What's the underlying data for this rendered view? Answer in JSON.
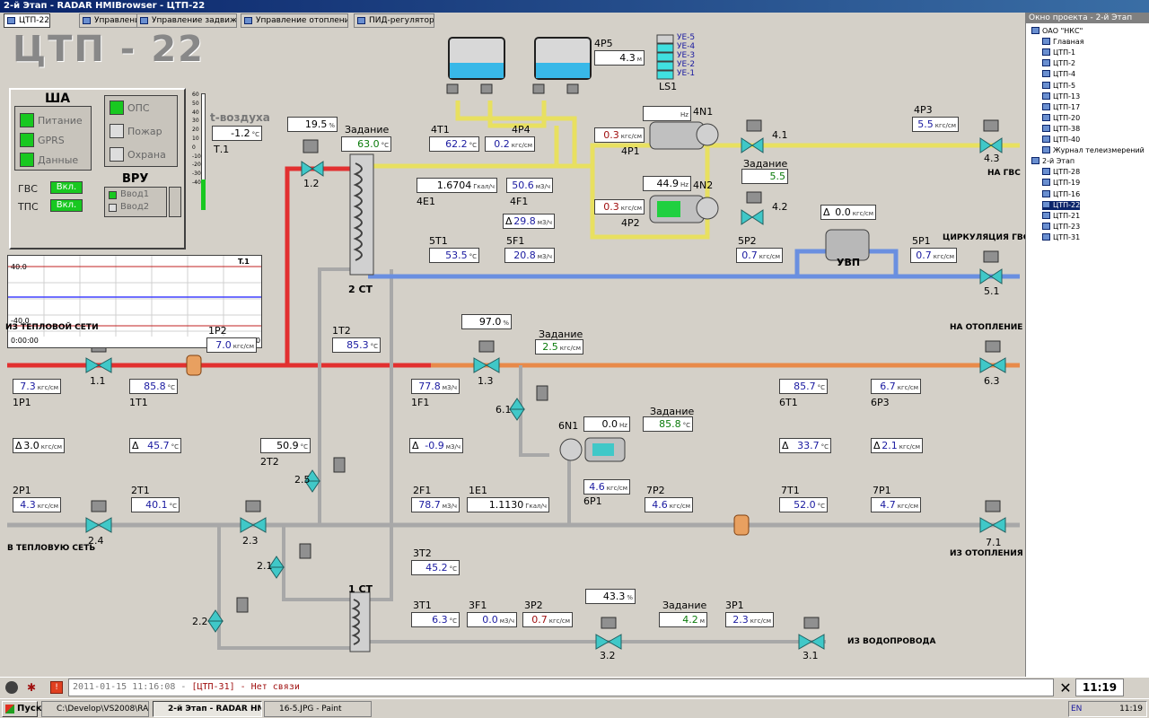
{
  "window": {
    "title": "2-й Этап - RADAR HMIBrowser - ЦТП-22"
  },
  "tabs": [
    "ЦТП-22",
    "Управление ГВС",
    "Управление задвижкой",
    "Управление отоплением",
    "ПИД-регуляторы"
  ],
  "page_title": "ЦТП - 22",
  "sha": {
    "title": "ША",
    "items": [
      "Питание",
      "GPRS",
      "Данные"
    ],
    "gvs_label": "ГВС",
    "tps_label": "ТПС",
    "on_label": "Вкл.",
    "ops_items": [
      "ОПС",
      "Пожар",
      "Охрана"
    ],
    "vru_title": "ВРУ",
    "vru_items": [
      "Ввод1",
      "Ввод2"
    ]
  },
  "air": {
    "label": "t-воздуха",
    "value": "-1.2",
    "unit": "°C",
    "tag": "Т.1",
    "scale": [
      "60",
      "50",
      "40",
      "30",
      "20",
      "10",
      "0",
      "-10",
      "-20",
      "-30",
      "-40"
    ]
  },
  "trend": {
    "tag": "T.1",
    "ymax": "40.0",
    "ymin": "-40.0",
    "time": "0:00:00",
    "end": "00:00"
  },
  "tree": {
    "header": "Окно проекта - 2-й Этап",
    "items": [
      "ОАО \"НКС\"",
      "Главная",
      "ЦТП-1",
      "ЦТП-2",
      "ЦТП-4",
      "ЦТП-5",
      "ЦТП-13",
      "ЦТП-17",
      "ЦТП-20",
      "ЦТП-38",
      "ЦТП-40",
      "Журнал телеизмерений",
      "2-й Этап",
      "ЦТП-28",
      "ЦТП-19",
      "ЦТП-16",
      "ЦТП-22",
      "ЦТП-21",
      "ЦТП-23",
      "ЦТП-31"
    ],
    "selected": 16
  },
  "tank": {
    "tag": "4Р5",
    "value": "4.3",
    "unit": "м",
    "ls": "LS1",
    "levels": [
      "УЕ-5",
      "УЕ-4",
      "УЕ-3",
      "УЕ-2",
      "УЕ-1"
    ]
  },
  "labels": {
    "setpoint": "Задание",
    "to_gvs": "НА ГВС",
    "circ_gvs": "ЦИРКУЛЯЦИЯ ГВС",
    "from_heat": "ИЗ ТЕПЛОВОЙ СЕТИ",
    "to_heating": "НА ОТОПЛЕНИЕ",
    "to_heat_net": "В ТЕПЛОВУЮ СЕТЬ",
    "from_heating": "ИЗ ОТОПЛЕНИЯ",
    "from_water": "ИЗ ВОДОПРОВОДА",
    "uvp": "УВП",
    "st2": "2 СТ",
    "st1": "1 СТ"
  },
  "values": {
    "v12pct": "19.5",
    "sp12": "63.0",
    "t41": "62.2",
    "p44": "0.2",
    "n41hz": "",
    "p41": "0.3",
    "sp42": "5.5",
    "p43": "5.5",
    "e41": "1.6704",
    "f41": "50.6",
    "df41": "29.8",
    "n42hz": "44.9",
    "p42": "0.3",
    "uvp": "0.0",
    "t51": "53.5",
    "f51": "20.8",
    "p52": "0.7",
    "p51": "0.7",
    "p12": "7.0",
    "t12": "85.3",
    "v13pct": "97.0",
    "sp13": "2.5",
    "p11": "7.3",
    "t11": "85.8",
    "f11": "77.8",
    "t61": "85.7",
    "p63": "6.7",
    "dp11": "3.0",
    "dt11": "45.7",
    "df11": "-0.9",
    "n61hz": "0.0",
    "sp61": "85.8",
    "dt61": "33.7",
    "dp61": "2.1",
    "t22": "50.9",
    "p61": "4.6",
    "p21": "4.3",
    "t21": "40.1",
    "f21": "78.7",
    "e11": "1.1130",
    "p72": "4.6",
    "t71": "52.0",
    "p71": "4.7",
    "t32": "45.2",
    "v32pct": "43.3",
    "t31": "6.3",
    "f31": "0.0",
    "p32": "0.7",
    "sp32": "4.2",
    "p31": "2.3"
  },
  "status": {
    "message_prefix": "2011-01-15 11:16:08 - ",
    "message_error": "[ЦТП-31] - Нет связи",
    "clock": "11:19"
  },
  "taskbar": {
    "start": "Пуск",
    "tasks": [
      "C:\\Develop\\VS2008\\RAD...",
      "2-й Этап - RADAR HM...",
      "16-5.JPG - Paint"
    ],
    "lang": "EN",
    "time": "11:19"
  },
  "colors": {
    "hot": "#e23030",
    "warm": "#e88a4a",
    "gvs": "#e8e060",
    "cold": "#6a8fe0",
    "grey": "#a8a8a8",
    "valve": "#40c8c8"
  }
}
